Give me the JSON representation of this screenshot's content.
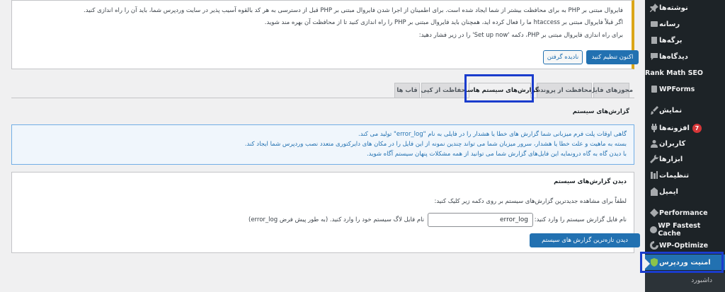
{
  "sidebar": {
    "items": [
      {
        "label": "نوشته‌ها",
        "icon": "pin-icon"
      },
      {
        "label": "رسانه",
        "icon": "media-icon"
      },
      {
        "label": "برگه‌ها",
        "icon": "page-icon"
      },
      {
        "label": "دیدگاه‌ها",
        "icon": "comment-icon"
      },
      {
        "label": "Rank Math SEO",
        "icon": ""
      },
      {
        "label": "WPForms",
        "icon": "wpforms-icon"
      },
      {
        "label": "نمایش",
        "icon": "brush-icon"
      },
      {
        "label": "افزونه‌ها",
        "icon": "plugin-icon",
        "badge": "7"
      },
      {
        "label": "کاربران",
        "icon": "user-icon"
      },
      {
        "label": "ابزارها",
        "icon": "wrench-icon"
      },
      {
        "label": "تنظیمات",
        "icon": "settings-icon"
      },
      {
        "label": "ایمیل",
        "icon": "email-icon"
      },
      {
        "label": "Performance",
        "icon": "performance-icon"
      },
      {
        "label": "WP Fastest Cache",
        "icon": "cache-icon"
      },
      {
        "label": "WP-Optimize",
        "icon": "optimize-icon"
      },
      {
        "label": "امنیت وردپرس",
        "icon": "shield-icon"
      }
    ],
    "submenu_label": "داشبورد"
  },
  "notice": {
    "line1": "فایروال مبتنی بر PHP به برای محافظت بیشتر از شما ایجاد شده است. برای اطمینان از اجرا شدن فایروال مبتنی بر PHP قبل از دسترسی به هر کد بالقوه آسیب پذیر در سایت وردپرس شما، باید آن را راه اندازی کنید.",
    "line2": "اگر قبلاً فایروال مبتنی بر htaccess ما را فعال کرده اید، همچنان باید فایروال مبتنی بر PHP را راه اندازی کنید تا از محافظت آن بهره مند شوید.",
    "line3": "برای راه اندازی فایروال مبتنی بر PHP، دکمه 'Set up now' را در زیر فشار دهید:",
    "setup_button": "اکنون تنظیم کنید",
    "dismiss_button": "نادیده گرفتن"
  },
  "tabs": [
    {
      "label": "مجوزهای فایل"
    },
    {
      "label": "محافظت از پرونده"
    },
    {
      "label": "گزارش‌های سیستم هاست"
    },
    {
      "label": "حفاظت از کپی"
    },
    {
      "label": "قاب ها"
    }
  ],
  "section_title": "گزارش‌های سیستم",
  "info": {
    "line1": "گاهی اوقات پلت فرم میزبانی شما گزارش های خطا یا هشدار را در فایلی به نام \"error_log\" تولید می کند.",
    "line2": "بسته به ماهیت و علت خطا یا هشدار، سرور میزبان شما می تواند چندین نمونه از این فایل را در مکان های دایرکتوری متعدد نصب وردپرس شما ایجاد کند.",
    "line3": "با دیدن گاه به گاه درونمایه این فایل‌های گزارش شما می توانید از همه مشکلات پنهان سیستم آگاه شوید."
  },
  "card": {
    "heading": "دیدن گزارش‌های سیستم",
    "description": "لطفاً برای مشاهده جدیدترین گزارش‌های سیستم بر روی دکمه زیر کلیک کنید:",
    "field_label": "نام فایل گزارش سیستم را وارد کنید:",
    "field_value": "error_log",
    "field_hint": "نام فایل لاگ سیستم خود را وارد کنید. (به طور پیش فرض error_log)",
    "view_button": "دیدن تازه‌ترین گزارش های سیستم"
  },
  "colors": {
    "sidebar_bg": "#1d2327",
    "accent": "#2271b1",
    "highlight": "#1a3ccd",
    "notice_border": "#dba617",
    "badge": "#d63638"
  }
}
